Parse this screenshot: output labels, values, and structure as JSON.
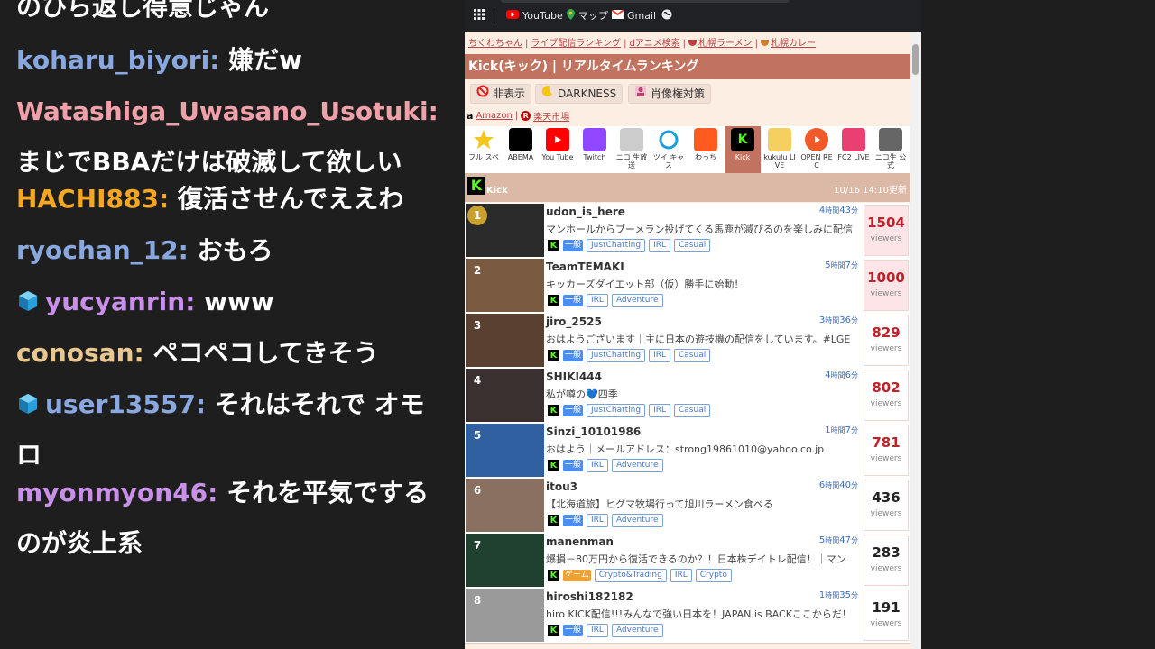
{
  "chat": {
    "messages": [
      {
        "user": "",
        "text": "のひら返し得意じゃん",
        "color": "#ffffff"
      },
      {
        "user": "koharu_biyori",
        "text": "嫌だw",
        "color": "#8aa8e0"
      },
      {
        "user": "Watashiga_Uwasano_Usotuki",
        "text": "まじでBBAだけは破滅して欲しい",
        "color": "#f0a0a8"
      },
      {
        "user": "HACHI883",
        "text": "復活させんでええわ",
        "color": "#f5a623"
      },
      {
        "user": "ryochan_12",
        "text": "おもろ",
        "color": "#8aa8e0"
      },
      {
        "user": "yucyanrin",
        "text": "www",
        "color": "#c890e8"
      },
      {
        "user": "conosan",
        "text": "ペコペコしてきそう",
        "color": "#e8c890"
      },
      {
        "user": "user13557",
        "text": "それはそれで オモロ",
        "color": "#8aa8e0"
      },
      {
        "user": "myonmyon46",
        "text": "それを平気でするのが炎上系",
        "color": "#c890e8"
      }
    ]
  },
  "bookmarks": {
    "apps_icon": "apps-grid-icon",
    "youtube": "YouTube",
    "maps": "マップ",
    "gmail": "Gmail"
  },
  "page": {
    "links": [
      "ちくわちゃん",
      "ライブ配信ランキング",
      "dアニメ検索",
      "札幌ラーメン",
      "札幌カレー"
    ],
    "title": "Kick(キック) | リアルタイムランキング",
    "toolbar": {
      "hide": "非表示",
      "darkness": "DARKNESS",
      "portrait": "肖像権対策"
    },
    "shops": {
      "amazon": "Amazon",
      "rakuten": "楽天市場"
    },
    "tabs": [
      {
        "label": "フル スペ",
        "icon": "star-icon",
        "color": "#f5c518"
      },
      {
        "label": "ABEMA",
        "icon": "abema-icon",
        "color": "#000000"
      },
      {
        "label": "You Tube",
        "icon": "youtube-icon",
        "color": "#ff0000"
      },
      {
        "label": "Twitch",
        "icon": "twitch-icon",
        "color": "#9146ff"
      },
      {
        "label": "ニコ 生放送",
        "icon": "niconico-icon",
        "color": "#cccccc"
      },
      {
        "label": "ツイ キャス",
        "icon": "twitcasting-icon",
        "color": "#1e9bde"
      },
      {
        "label": "わっち",
        "icon": "watch-icon",
        "color": "#ff5a1f"
      },
      {
        "label": "Kick",
        "icon": "kick-icon",
        "color": "#53fc18"
      },
      {
        "label": "kukulu LIVE",
        "icon": "kukulu-icon",
        "color": "#f5d060"
      },
      {
        "label": "OPEN REC",
        "icon": "openrec-icon",
        "color": "#f05a28"
      },
      {
        "label": "FC2 LIVE",
        "icon": "fc2-icon",
        "color": "#e84070"
      },
      {
        "label": "ニコ生 公式",
        "icon": "nicolive-official-icon",
        "color": "#666666"
      }
    ],
    "section": {
      "label": "Kick",
      "updated": "10/16 14:10更新"
    },
    "streams": [
      {
        "rank": "1",
        "name": "udon_is_here",
        "h": "4",
        "m": "43",
        "desc": "マンホールからブーメラン投げてくる馬鹿が滅びるのを楽しみに配信",
        "cat": "一般",
        "tags": [
          "JustChatting",
          "IRL",
          "Casual"
        ],
        "viewers": "1504",
        "viewers_label": "viewers",
        "thumb": "#2a2a2a"
      },
      {
        "rank": "2",
        "name": "TeamTEMAKI",
        "h": "5",
        "m": "7",
        "desc": "キッカーズダイエット部（仮）勝手に始動！",
        "cat": "一般",
        "tags": [
          "IRL",
          "Adventure"
        ],
        "viewers": "1000",
        "viewers_label": "viewers",
        "thumb": "#7a5a40"
      },
      {
        "rank": "3",
        "name": "jiro_2525",
        "h": "3",
        "m": "36",
        "desc": "おはようございます｜主に日本の遊技機の配信をしています。#LGE",
        "cat": "一般",
        "tags": [
          "JustChatting",
          "IRL",
          "Casual"
        ],
        "viewers": "829",
        "viewers_label": "viewers",
        "thumb": "#5a4030"
      },
      {
        "rank": "4",
        "name": "SHIKI444",
        "h": "4",
        "m": "6",
        "desc": "私が噂の💙四季",
        "cat": "一般",
        "tags": [
          "JustChatting",
          "IRL",
          "Casual"
        ],
        "viewers": "802",
        "viewers_label": "viewers",
        "thumb": "#3a3030"
      },
      {
        "rank": "5",
        "name": "Sinzi_10101986",
        "h": "1",
        "m": "7",
        "desc": "おはよう｜メールアドレス：strong19861010@yahoo.co.jp",
        "cat": "一般",
        "tags": [
          "IRL",
          "Adventure"
        ],
        "viewers": "781",
        "viewers_label": "viewers",
        "thumb": "#3060a0"
      },
      {
        "rank": "6",
        "name": "itou3",
        "h": "6",
        "m": "40",
        "desc": "【北海道旅】ヒグマ牧場行って旭川ラーメン食べる",
        "cat": "一般",
        "tags": [
          "IRL",
          "Adventure"
        ],
        "viewers": "436",
        "viewers_label": "viewers",
        "thumb": "#8a7060"
      },
      {
        "rank": "7",
        "name": "manenman",
        "h": "5",
        "m": "47",
        "desc": "爆損－80万円から復活できるのか？！日本株デイトレ配信！｜マン",
        "cat": "ゲーム",
        "tags": [
          "Crypto&Trading",
          "IRL",
          "Crypto"
        ],
        "viewers": "283",
        "viewers_label": "viewers",
        "thumb": "#204030"
      },
      {
        "rank": "8",
        "name": "hiroshi182182",
        "h": "1",
        "m": "35",
        "desc": "hiro KICK配信!!!みんなで強い日本を！JAPAN is BACKここからだ！",
        "cat": "一般",
        "tags": [
          "IRL",
          "Adventure"
        ],
        "viewers": "191",
        "viewers_label": "viewers",
        "thumb": "#9a9a9a"
      }
    ],
    "hour_unit": "時間",
    "min_unit": "分"
  }
}
